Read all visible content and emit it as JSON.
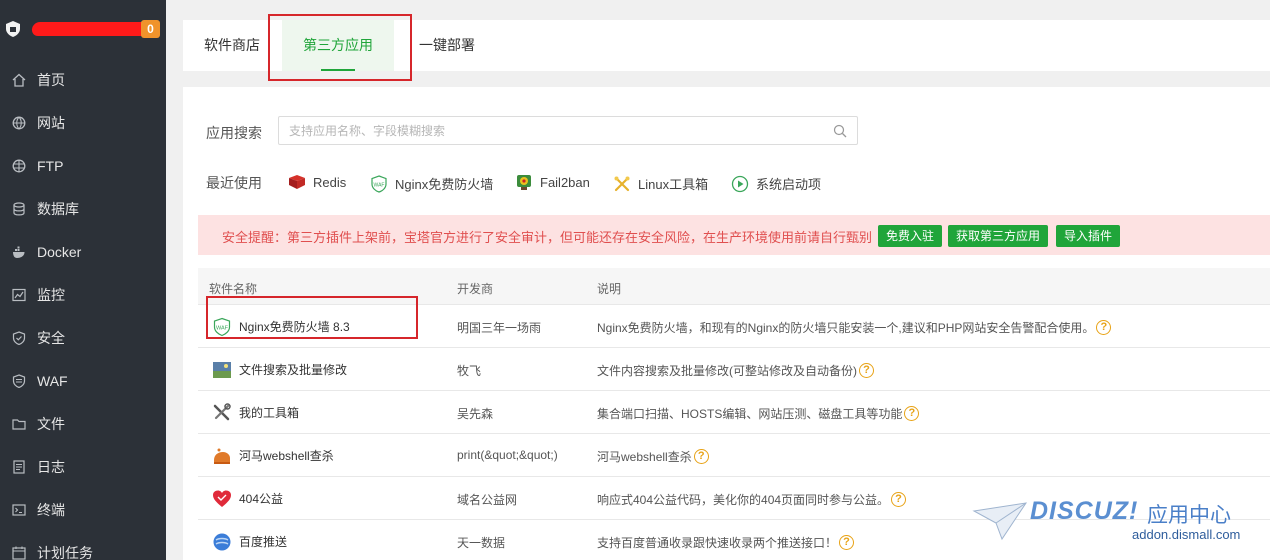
{
  "sidebar": {
    "badge": "0",
    "items": [
      {
        "label": "首页",
        "icon": "home-icon"
      },
      {
        "label": "网站",
        "icon": "globe-icon"
      },
      {
        "label": "FTP",
        "icon": "ftp-globe-icon"
      },
      {
        "label": "数据库",
        "icon": "database-icon"
      },
      {
        "label": "Docker",
        "icon": "docker-icon"
      },
      {
        "label": "监控",
        "icon": "monitor-icon"
      },
      {
        "label": "安全",
        "icon": "shield-icon"
      },
      {
        "label": "WAF",
        "icon": "waf-shield-icon"
      },
      {
        "label": "文件",
        "icon": "folder-icon"
      },
      {
        "label": "日志",
        "icon": "log-icon"
      },
      {
        "label": "终端",
        "icon": "terminal-icon"
      },
      {
        "label": "计划任务",
        "icon": "schedule-icon"
      }
    ]
  },
  "tabs": {
    "store": "软件商店",
    "third_party": "第三方应用",
    "deploy": "一键部署"
  },
  "search": {
    "label": "应用搜索",
    "placeholder": "支持应用名称、字段模糊搜索"
  },
  "recent": {
    "label": "最近使用",
    "items": [
      {
        "label": "Redis",
        "icon": "redis-icon"
      },
      {
        "label": "Nginx免费防火墙",
        "icon": "waf-icon"
      },
      {
        "label": "Fail2ban",
        "icon": "fail2ban-icon"
      },
      {
        "label": "Linux工具箱",
        "icon": "tools-icon"
      },
      {
        "label": "系统启动项",
        "icon": "play-icon"
      }
    ]
  },
  "alert": {
    "text": "安全提醒：第三方插件上架前，宝塔官方进行了安全审计，但可能还存在安全风险，在生产环境使用前请自行甄别",
    "btn_free": "免费入驻",
    "btn_get": "获取第三方应用",
    "btn_import": "导入插件"
  },
  "table": {
    "headers": {
      "name": "软件名称",
      "developer": "开发商",
      "desc": "说明"
    },
    "rows": [
      {
        "name": "Nginx免费防火墙 8.3",
        "developer": "明国三年一场雨",
        "desc": "Nginx免费防火墙，和现有的Nginx的防火墙只能安装一个,建议和PHP网站安全告警配合使用。",
        "icon": "waf-icon"
      },
      {
        "name": "文件搜索及批量修改",
        "developer": "牧飞",
        "desc": "文件内容搜索及批量修改(可整站修改及自动备份)",
        "icon": "file-search-icon"
      },
      {
        "name": "我的工具箱",
        "developer": "吴先森",
        "desc": "集合端口扫描、HOSTS编辑、网站压测、磁盘工具等功能",
        "icon": "toolbox-icon"
      },
      {
        "name": "河马webshell查杀",
        "developer": "print(&quot;&quot;)",
        "desc": "河马webshell查杀",
        "icon": "hippo-icon"
      },
      {
        "name": "404公益",
        "developer": "域名公益网",
        "desc": "响应式404公益代码，美化你的404页面同时参与公益。",
        "icon": "heart-icon"
      },
      {
        "name": "百度推送",
        "developer": "天一数据",
        "desc": "支持百度普通收录跟快速收录两个推送接口！",
        "icon": "baidu-push-icon"
      }
    ]
  },
  "watermark": {
    "title": "DISCUZ!",
    "cn": "应用中心",
    "url": "addon.dismall.com"
  }
}
